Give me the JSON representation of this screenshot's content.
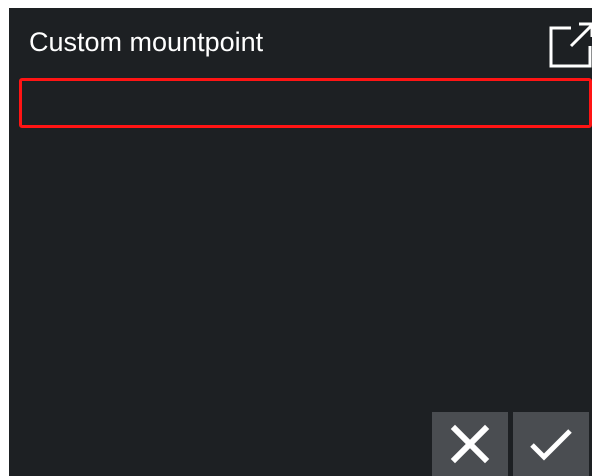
{
  "dialog": {
    "title": "Custom mountpoint",
    "input_value": "",
    "expand_icon": "expand-external-icon",
    "cancel_icon": "close-icon",
    "confirm_icon": "check-icon"
  },
  "colors": {
    "background": "#1d2023",
    "text": "#ffffff",
    "input_border": "#ff1414",
    "button_bg": "#4a4d51"
  }
}
